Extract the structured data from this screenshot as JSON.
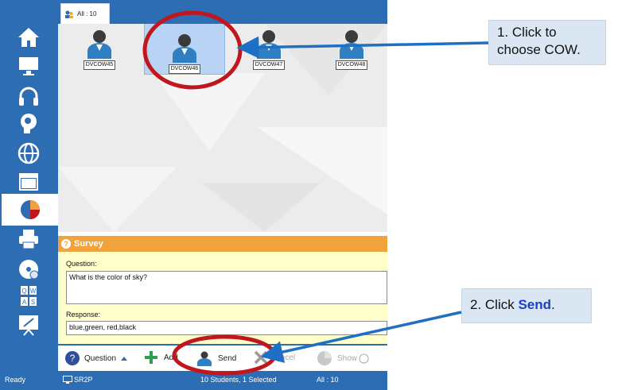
{
  "tab": {
    "label": "All : 10"
  },
  "students": [
    "DVCOW45",
    "DVCOW46",
    "DVCOW47",
    "DVCOW48"
  ],
  "selected_student": "DVCOW46",
  "sidebar": {
    "items": [
      "home-icon",
      "monitor-icon",
      "headphones-icon",
      "brain-icon",
      "globe-icon",
      "window-icon",
      "pie-chart-icon",
      "printer-icon",
      "disc-icon",
      "keyboard-icon",
      "presentation-icon"
    ]
  },
  "survey": {
    "title": "Survey",
    "question_label": "Question:",
    "question_text": "What is the color of sky?",
    "response_label": "Response:",
    "response_text": "blue,green, red,black"
  },
  "toolbar": {
    "question": "Question",
    "add": "Add",
    "send": "Send",
    "cancel": "Cancel",
    "show": "Show"
  },
  "status": {
    "ready": "Ready",
    "room": "SR2P",
    "students": "10 Students, 1 Selected",
    "all": "All : 10"
  },
  "callouts": {
    "step1_line1": "1. Click to",
    "step1_line2": "choose COW.",
    "step2_prefix": "2. Click ",
    "step2_bold": "Send",
    "step2_suffix": "."
  },
  "colors": {
    "accent": "#2d6db4",
    "survey_header": "#f0a33d",
    "survey_bg": "#ffffcc",
    "annotation_circle": "#c0161c",
    "arrow": "#1f6fc5"
  }
}
